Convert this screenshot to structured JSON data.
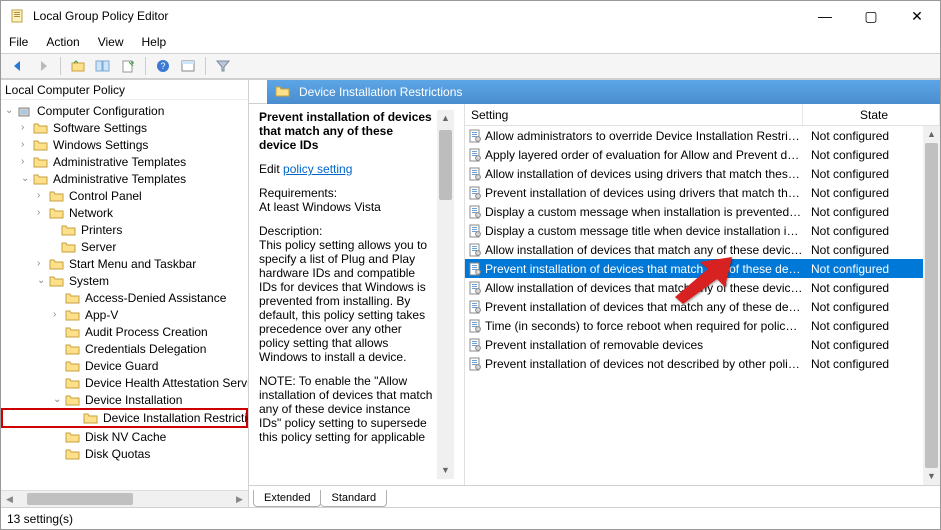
{
  "window": {
    "title": "Local Group Policy Editor",
    "minimize": "—",
    "maximize": "▢",
    "close": "✕"
  },
  "menus": {
    "file": "File",
    "action": "Action",
    "view": "View",
    "help": "Help"
  },
  "tree": {
    "root": "Local Computer Policy",
    "computer_config": "Computer Configuration",
    "software": "Software Settings",
    "windows_settings": "Windows Settings",
    "admin_templates_1": "Administrative Templates",
    "admin_templates_2": "Administrative Templates",
    "control_panel": "Control Panel",
    "network": "Network",
    "printers": "Printers",
    "server": "Server",
    "start_menu": "Start Menu and Taskbar",
    "system": "System",
    "access_denied": "Access-Denied Assistance",
    "app_v": "App-V",
    "audit": "Audit Process Creation",
    "credentials": "Credentials Delegation",
    "device_guard": "Device Guard",
    "device_health": "Device Health Attestation Service",
    "device_install": "Device Installation",
    "device_install_restrictions": "Device Installation Restrictions",
    "disk_nv": "Disk NV Cache",
    "disk_quotas": "Disk Quotas"
  },
  "content": {
    "header_title": "Device Installation Restrictions",
    "detail_title": "Prevent installation of devices that match any of these device IDs",
    "edit_label": "Edit",
    "policy_link": "policy setting",
    "req_label": "Requirements:",
    "req_value": "At least Windows Vista",
    "desc_label": "Description:",
    "desc_text": "This policy setting allows you to specify a list of Plug and Play hardware IDs and compatible IDs for devices that Windows is prevented from installing. By default, this policy setting takes precedence over any other policy setting that allows Windows to install a device.",
    "desc_note": "NOTE: To enable the \"Allow installation of devices that match any of these device instance IDs\" policy setting to supersede this policy setting for applicable"
  },
  "list": {
    "col_setting": "Setting",
    "col_state": "State",
    "rows": [
      {
        "setting": "Allow administrators to override Device Installation Restricti...",
        "state": "Not configured",
        "selected": false
      },
      {
        "setting": "Apply layered order of evaluation for Allow and Prevent devi...",
        "state": "Not configured",
        "selected": false
      },
      {
        "setting": "Allow installation of devices using drivers that match these ...",
        "state": "Not configured",
        "selected": false
      },
      {
        "setting": "Prevent installation of devices using drivers that match thes...",
        "state": "Not configured",
        "selected": false
      },
      {
        "setting": "Display a custom message when installation is prevented by...",
        "state": "Not configured",
        "selected": false
      },
      {
        "setting": "Display a custom message title when device installation is pr...",
        "state": "Not configured",
        "selected": false
      },
      {
        "setting": "Allow installation of devices that match any of these device ...",
        "state": "Not configured",
        "selected": false
      },
      {
        "setting": "Prevent installation of devices that match any of these devic...",
        "state": "Not configured",
        "selected": true
      },
      {
        "setting": "Allow installation of devices that match any of these device ...",
        "state": "Not configured",
        "selected": false
      },
      {
        "setting": "Prevent installation of devices that match any of these devic...",
        "state": "Not configured",
        "selected": false
      },
      {
        "setting": "Time (in seconds) to force reboot when required for policy c...",
        "state": "Not configured",
        "selected": false
      },
      {
        "setting": "Prevent installation of removable devices",
        "state": "Not configured",
        "selected": false
      },
      {
        "setting": "Prevent installation of devices not described by other policy ...",
        "state": "Not configured",
        "selected": false
      }
    ]
  },
  "tabs": {
    "extended": "Extended",
    "standard": "Standard"
  },
  "status": "13 setting(s)"
}
